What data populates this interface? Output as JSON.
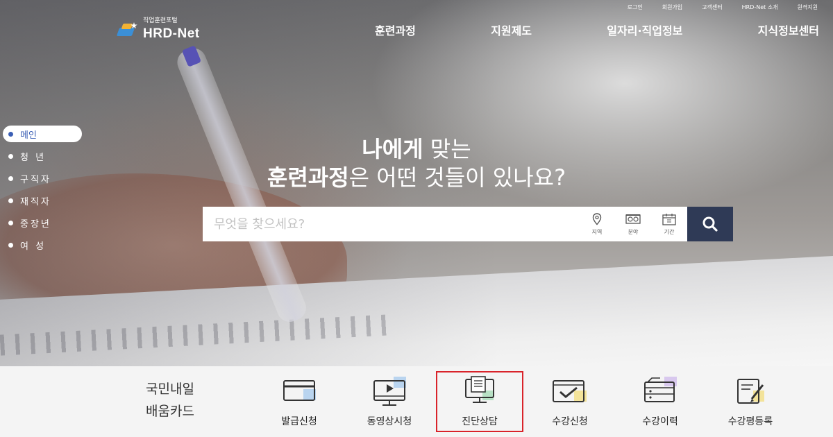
{
  "brand": {
    "tagline": "직업훈련포털",
    "name": "HRD-Net"
  },
  "util_links": [
    "로그인",
    "회원가입",
    "고객센터",
    "HRD-Net 소개",
    "원격지원"
  ],
  "gnb": [
    "훈련과정",
    "지원제도",
    "일자리·직업정보",
    "지식정보센터"
  ],
  "side_nav": [
    {
      "label": "메인",
      "active": true
    },
    {
      "label": "청 년",
      "active": false
    },
    {
      "label": "구직자",
      "active": false
    },
    {
      "label": "재직자",
      "active": false
    },
    {
      "label": "중장년",
      "active": false
    },
    {
      "label": "여 성",
      "active": false
    }
  ],
  "headline": {
    "line1_bold": "나에게",
    "line1_rest": " 맞는",
    "line2_bold": "훈련과정",
    "line2_rest": "은 어떤 것들이 있나요?"
  },
  "search": {
    "placeholder": "무엇을 찾으세요?",
    "filters": [
      {
        "label": "지역",
        "icon": "location-pin-icon"
      },
      {
        "label": "분야",
        "icon": "category-icon"
      },
      {
        "label": "기간",
        "icon": "calendar-icon"
      }
    ],
    "button_icon": "search-icon"
  },
  "card": {
    "title_line1": "국민내일",
    "title_line2": "배움카드"
  },
  "quick_menu": [
    {
      "label": "발급신청",
      "icon": "card-icon"
    },
    {
      "label": "동영상시청",
      "icon": "video-monitor-icon"
    },
    {
      "label": "진단상담",
      "icon": "consult-monitor-icon",
      "highlighted": true
    },
    {
      "label": "수강신청",
      "icon": "checkbox-icon"
    },
    {
      "label": "수강이력",
      "icon": "history-folder-icon"
    },
    {
      "label": "수강평등록",
      "icon": "review-edit-icon"
    }
  ],
  "colors": {
    "accent": "#3b5fb5",
    "search_button": "#2f3a56",
    "highlight": "#d9232a"
  }
}
